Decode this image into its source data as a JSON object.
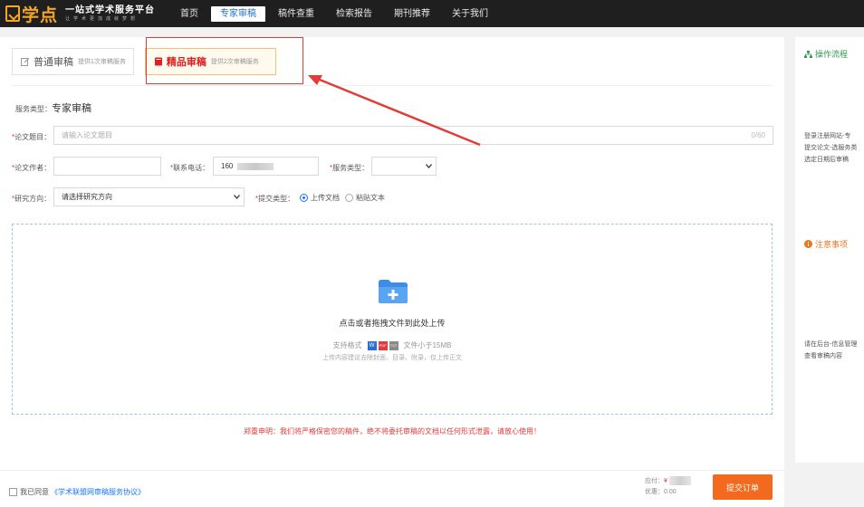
{
  "brand": {
    "name": "学点",
    "title": "一站式学术服务平台",
    "slogan": "让学术更加成就梦想"
  },
  "nav": {
    "items": [
      {
        "label": "首页"
      },
      {
        "label": "专家审稿"
      },
      {
        "label": "稿件查重"
      },
      {
        "label": "检索报告"
      },
      {
        "label": "期刊推荐"
      },
      {
        "label": "关于我们"
      }
    ]
  },
  "tabs": {
    "normal": {
      "title": "普通审稿",
      "sub": "提供1次审稿服务"
    },
    "premium": {
      "title": "精品审稿",
      "sub": "提供2次审稿服务"
    }
  },
  "form": {
    "service_type_label": "服务类型：",
    "service_type_value": "专家审稿",
    "title_label": "论文题目：",
    "title_placeholder": "请输入论文题目",
    "title_counter": "0/60",
    "author_label": "论文作者：",
    "phone_label": "联系电话：",
    "phone_value": "160",
    "service_label": "服务类型：",
    "research_label": "研究方向：",
    "research_value": "请选择研究方向",
    "submit_type_label": "提交类型：",
    "radio_upload": "上传文档",
    "radio_paste": "粘贴文本"
  },
  "upload": {
    "main_text": "点击或者拖拽文件到此处上传",
    "formats_label": "支持格式",
    "badge_w": "W",
    "badge_pdf": "PDF",
    "badge_txt": "TXT",
    "size_text": "文件小于15MB",
    "hint": "上传内容建议去除封面、目录、附录，仅上传正文"
  },
  "disclaimer": "郑重申明：我们将严格保密您的稿件，绝不将委托审稿的文档以任何形式泄露，请放心使用！",
  "bottom": {
    "agree_text": "我已同意",
    "agree_link": "《学术联盟网审稿服务协议》",
    "price_label": "应付：",
    "currency": "¥",
    "discount_label": "优惠：",
    "discount_value": "0.00",
    "submit_label": "提交订单"
  },
  "side": {
    "process_title": "操作流程",
    "process_lines": [
      "登录注册网站-专",
      "提交论文-选服务类",
      "选定日期后审稿"
    ],
    "notes_title": "注意事项",
    "notes_lines": [
      "请在后台-信息管理",
      "查看审稿内容"
    ]
  },
  "colors": {
    "nav_bg": "#1f1f1f",
    "brand_orange": "#f5a623",
    "accent_blue": "#1677ff",
    "alert_red": "#e53a3a",
    "submit_orange": "#f36a1e"
  }
}
